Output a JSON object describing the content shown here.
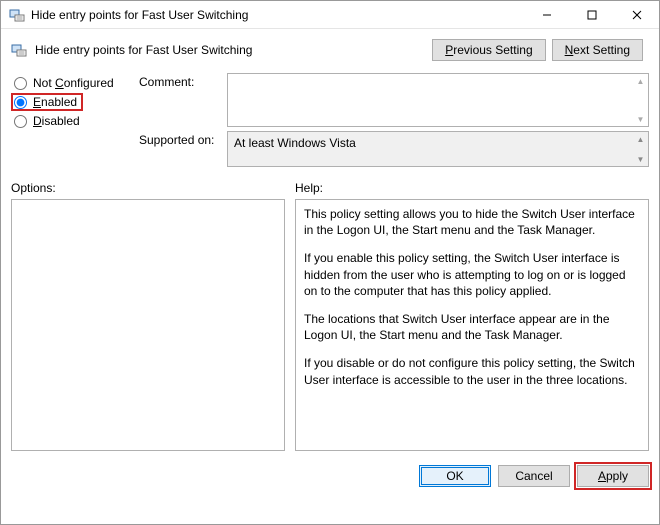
{
  "window": {
    "title": "Hide entry points for Fast User Switching",
    "heading": "Hide entry points for Fast User Switching"
  },
  "nav": {
    "previous": "Previous Setting",
    "next": "Next Setting"
  },
  "radios": {
    "not_configured": "Not Configured",
    "enabled": "Enabled",
    "disabled": "Disabled",
    "selected": "enabled"
  },
  "labels": {
    "comment": "Comment:",
    "supported": "Supported on:",
    "options": "Options:",
    "help": "Help:"
  },
  "fields": {
    "comment": "",
    "supported": "At least Windows Vista"
  },
  "help": {
    "p1": "This policy setting allows you to hide the Switch User interface in the Logon UI, the Start menu and the Task Manager.",
    "p2": "If you enable this policy setting, the Switch User interface is hidden from the user who is attempting to log on or is logged on to the computer that has this policy applied.",
    "p3": "The locations that Switch User interface appear are in the Logon UI, the Start menu and the Task Manager.",
    "p4": "If you disable or do not configure this policy setting, the Switch User interface is accessible to the user in the three locations."
  },
  "buttons": {
    "ok": "OK",
    "cancel": "Cancel",
    "apply": "Apply"
  }
}
